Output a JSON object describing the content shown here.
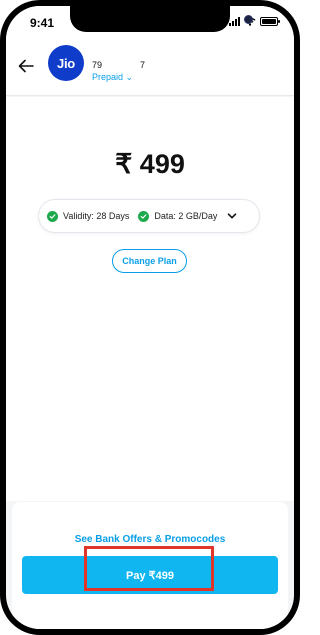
{
  "status_bar": {
    "time": "9:41"
  },
  "header": {
    "logo_text": "Jio",
    "number_start": "79",
    "number_end": "7",
    "plan_type": "Prepaid ⌄"
  },
  "plan": {
    "price": "₹ 499",
    "validity": "Validity: 28 Days",
    "data": "Data: 2 GB/Day",
    "change_plan_label": "Change Plan"
  },
  "footer": {
    "bank_offers_label": "See Bank Offers & Promocodes",
    "pay_label": "Pay ₹499"
  },
  "colors": {
    "accent": "#0a9ee8",
    "pay_button": "#0fb6f0",
    "jio_blue": "#0f3cc9",
    "check_green": "#1fa94d",
    "highlight_red": "#e0362a"
  },
  "icons": [
    "back-arrow-icon",
    "check-circle-icon",
    "chevron-down-icon",
    "signal-icon",
    "wifi-icon",
    "battery-icon"
  ]
}
